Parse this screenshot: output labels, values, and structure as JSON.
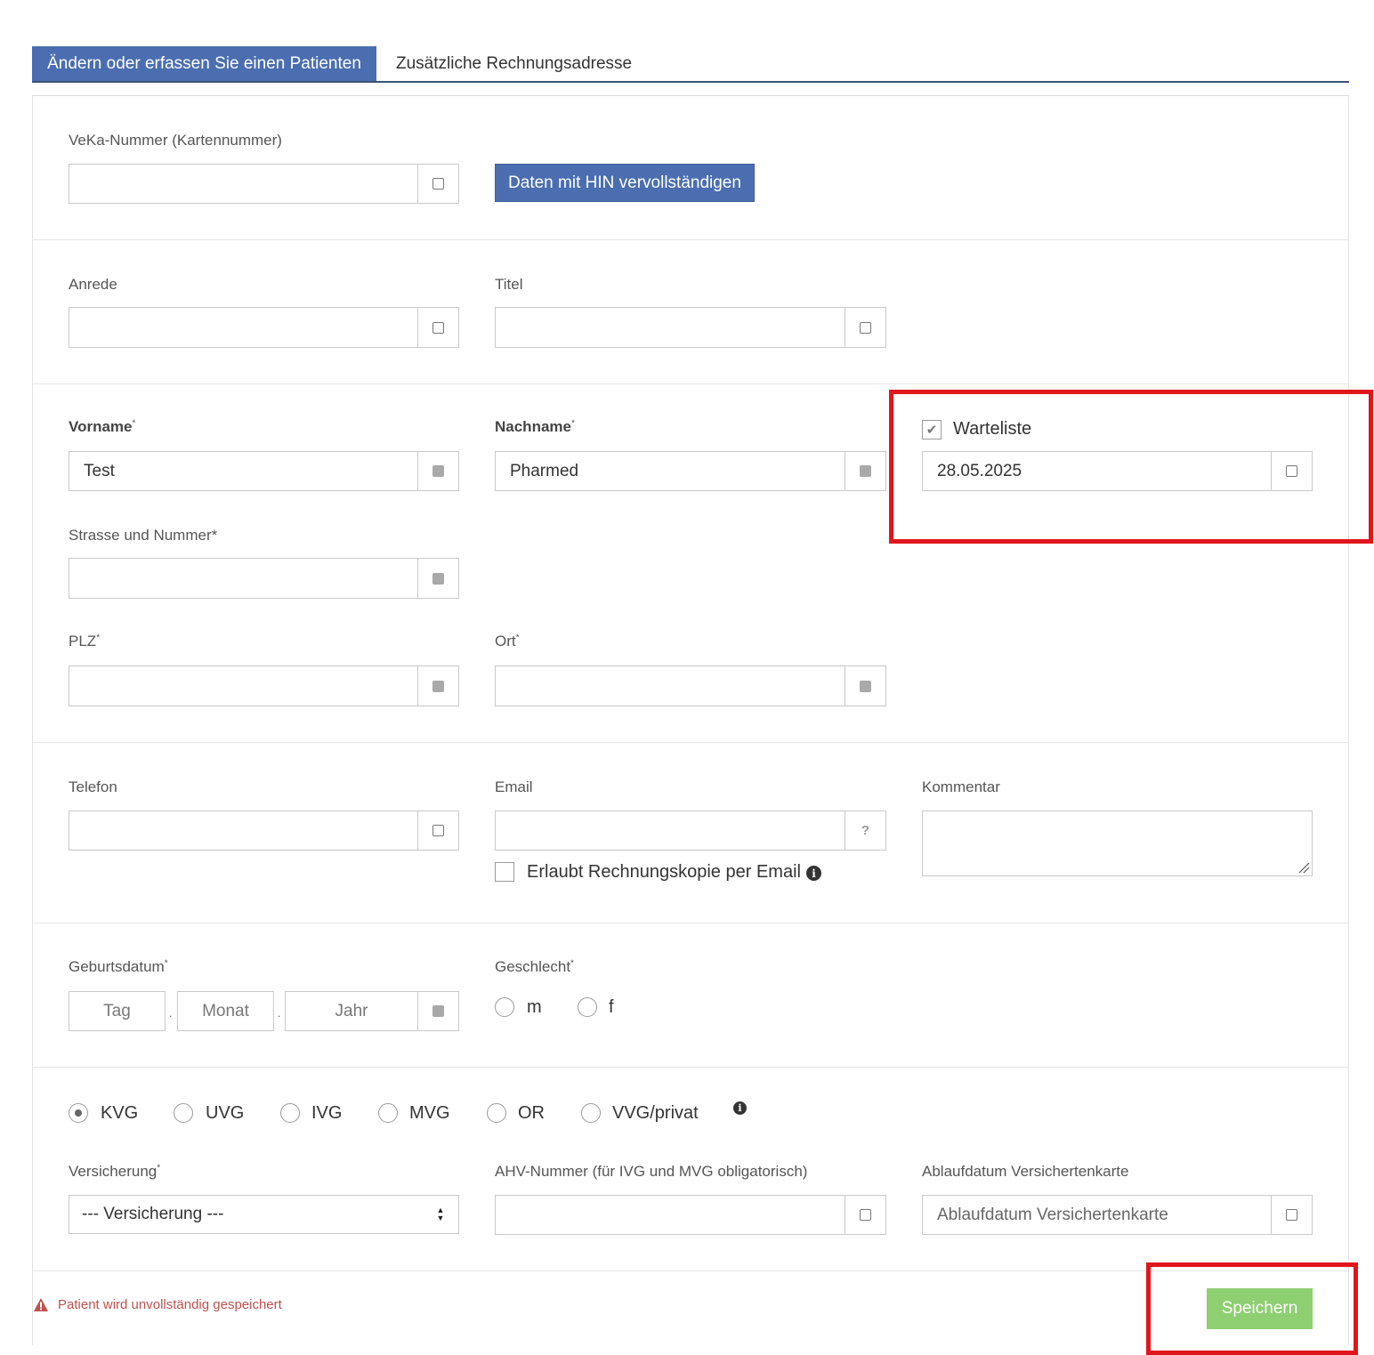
{
  "tabs": {
    "active": "Ändern oder erfassen Sie einen Patienten",
    "second": "Zusätzliche Rechnungsadresse"
  },
  "veka": {
    "label": "VeKa-Nummer (Kartennummer)",
    "value": "",
    "hin_button": "Daten mit HIN vervollständigen"
  },
  "anrede": {
    "label": "Anrede",
    "value": ""
  },
  "titel": {
    "label": "Titel",
    "value": ""
  },
  "vorname": {
    "label": "Vorname",
    "required": "*",
    "value": "Test"
  },
  "nachname": {
    "label": "Nachname",
    "required": "*",
    "value": "Pharmed"
  },
  "warteliste": {
    "label": "Warteliste",
    "checked": true,
    "date": "28.05.2025"
  },
  "strasse": {
    "label": "Strasse und Nummer*",
    "value": ""
  },
  "plz": {
    "label": "PLZ",
    "required": "*",
    "value": ""
  },
  "ort": {
    "label": "Ort",
    "required": "*",
    "value": ""
  },
  "telefon": {
    "label": "Telefon",
    "value": ""
  },
  "email": {
    "label": "Email",
    "value": "",
    "addon": "?",
    "copy_label": "Erlaubt Rechnungskopie per Email",
    "copy_checked": false
  },
  "kommentar": {
    "label": "Kommentar",
    "value": ""
  },
  "geburtsdatum": {
    "label": "Geburtsdatum",
    "required": "*",
    "tag": "Tag",
    "monat": "Monat",
    "jahr": "Jahr",
    "separator": "."
  },
  "geschlecht": {
    "label": "Geschlecht",
    "required": "*",
    "options": [
      "m",
      "f"
    ],
    "selected": null
  },
  "gesetz": {
    "options": [
      "KVG",
      "UVG",
      "IVG",
      "MVG",
      "OR",
      "VVG/privat"
    ],
    "selected": "KVG"
  },
  "versicherung": {
    "label": "Versicherung",
    "required": "*",
    "selected": "--- Versicherung ---"
  },
  "ahv": {
    "label": "AHV-Nummer (für IVG und MVG obligatorisch)",
    "value": ""
  },
  "ablauf": {
    "label": "Ablaufdatum Versichertenkarte",
    "placeholder": "Ablaufdatum Versichertenkarte"
  },
  "footer": {
    "warning": "Patient wird unvollständig gespeichert",
    "save": "Speichern"
  },
  "colors": {
    "tab_active": "#4a6eb0",
    "save_button": "#8dcf71",
    "highlight": "#e0161c",
    "warning": "#c0504d"
  },
  "icons": [
    "warning-icon",
    "info-icon",
    "checkbox-icon",
    "select-arrows-icon",
    "resize-handle-icon"
  ]
}
